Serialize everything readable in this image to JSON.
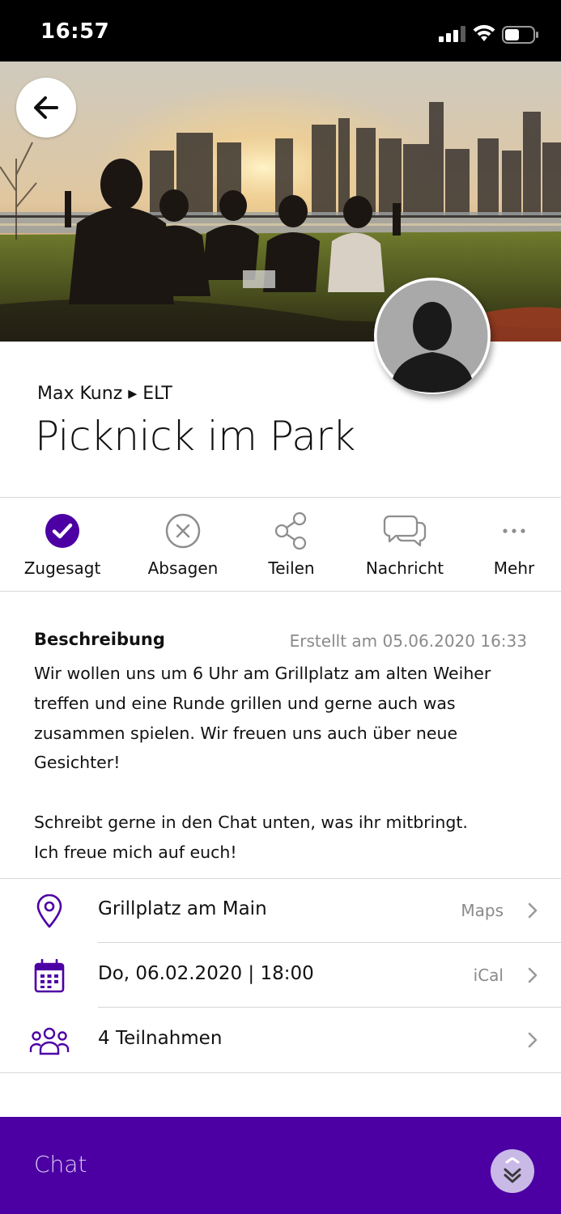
{
  "status_bar": {
    "time": "16:57"
  },
  "event": {
    "breadcrumb": "Max Kunz ▸ ELT",
    "title": "Picknick im Park"
  },
  "actions": [
    {
      "label": "Zugesagt",
      "icon": "check-circle-icon"
    },
    {
      "label": "Absagen",
      "icon": "cancel-circle-icon"
    },
    {
      "label": "Teilen",
      "icon": "share-icon"
    },
    {
      "label": "Nachricht",
      "icon": "chat-bubbles-icon"
    },
    {
      "label": "Mehr",
      "icon": "more-dots-icon"
    }
  ],
  "description": {
    "heading": "Beschreibung",
    "created": "Erstellt am 05.06.2020 16:33",
    "text": "Wir wollen uns um 6 Uhr am Grillplatz am alten Weiher treffen und eine Runde grillen und gerne auch was zusammen spielen. Wir freuen uns auch über neue Gesichter!\n\nSchreibt gerne in den Chat unten, was ihr mitbringt.\nIch freue mich auf euch!"
  },
  "details": [
    {
      "icon": "location-pin-icon",
      "text": "Grillplatz am Main",
      "link": "Maps"
    },
    {
      "icon": "calendar-icon",
      "text": "Do, 06.02.2020 | 18:00",
      "link": "iCal"
    },
    {
      "icon": "group-icon",
      "text": "4 Teilnahmen",
      "link": ""
    }
  ],
  "chat": {
    "label": "Chat"
  },
  "colors": {
    "accent": "#4c00a4",
    "accent_light": "#c9b9e6"
  }
}
